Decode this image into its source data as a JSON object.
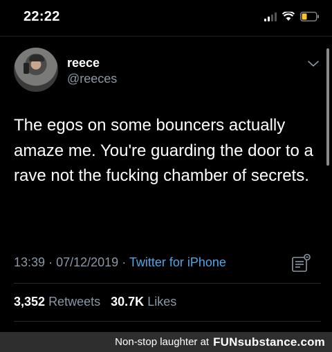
{
  "status_bar": {
    "time": "22:22"
  },
  "tweet": {
    "author_name": "reece",
    "author_handle": "@reeces",
    "text": "The egos on some bouncers actually amaze me. You're guarding the door to a rave not the fucking chamber of secrets.",
    "time": "13:39",
    "separator": "·",
    "date": "07/12/2019",
    "source": "Twitter for iPhone",
    "retweets_count": "3,352",
    "retweets_label": "Retweets",
    "likes_count": "30.7K",
    "likes_label": "Likes"
  },
  "watermark": {
    "text": "Non-stop laughter at",
    "brand": "FUNsubstance.com"
  },
  "colors": {
    "background": "#000000",
    "secondary_text": "#8b98a5",
    "link": "#4fa6e8",
    "watermark_bar": "#2e2e2e"
  },
  "icons": [
    "cellular-signal-icon",
    "wifi-icon",
    "battery-icon",
    "chevron-down-icon",
    "analytics-icon"
  ]
}
